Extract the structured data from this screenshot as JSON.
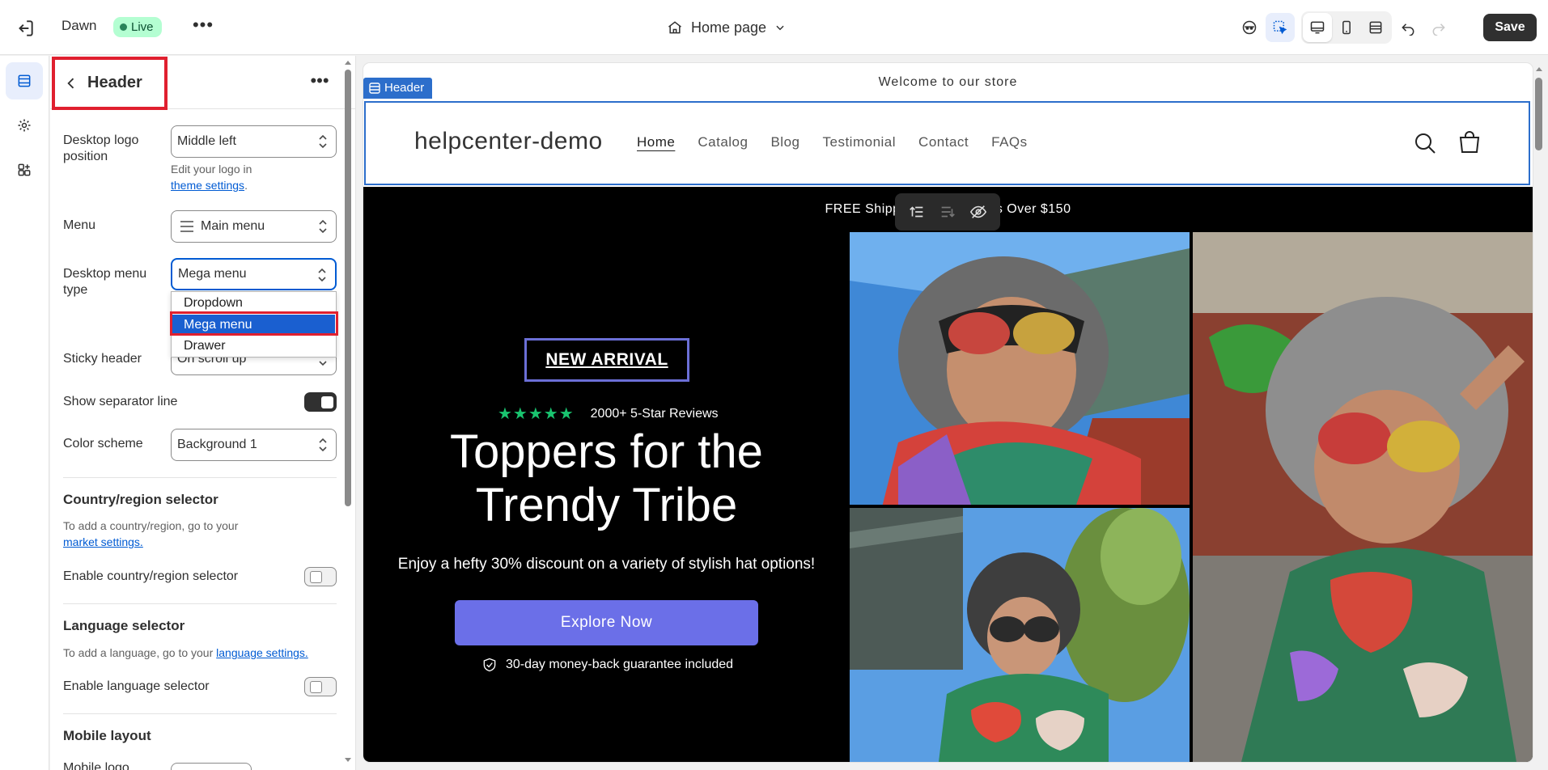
{
  "topbar": {
    "theme_name": "Dawn",
    "status": "Live",
    "more": "•••",
    "page_selector": "Home page",
    "save_label": "Save"
  },
  "panel": {
    "title": "Header",
    "more": "•••",
    "fields": {
      "logo_position_label": "Desktop logo position",
      "logo_position_value": "Middle left",
      "logo_help_prefix": "Edit your logo in",
      "logo_help_link": "theme settings",
      "menu_label": "Menu",
      "menu_value": "Main menu",
      "menu_type_label": "Desktop menu type",
      "menu_type_value": "Mega menu",
      "sticky_label": "Sticky header",
      "sticky_value": "On scroll up",
      "separator_label": "Show separator line",
      "separator_on": true,
      "color_scheme_label": "Color scheme",
      "color_scheme_value": "Background 1"
    },
    "dropdown_options": [
      "Dropdown",
      "Mega menu",
      "Drawer"
    ],
    "dropdown_selected": "Mega menu",
    "country": {
      "title": "Country/region selector",
      "help_prefix": "To add a country/region, go to your",
      "help_link": "market settings.",
      "enable_label": "Enable country/region selector",
      "enabled": false
    },
    "language": {
      "title": "Language selector",
      "help_prefix": "To add a language, go to your",
      "help_link": "language settings.",
      "enable_label": "Enable language selector",
      "enabled": false
    },
    "mobile": {
      "title": "Mobile layout",
      "logo_label": "Mobile logo"
    }
  },
  "preview": {
    "announcement": "Welcome to our store",
    "section_tag": "Header",
    "store_name": "helpcenter-demo",
    "nav": [
      "Home",
      "Catalog",
      "Blog",
      "Testimonial",
      "Contact",
      "FAQs"
    ],
    "free_shipping": "FREE Shipping on All Orders Over $150",
    "badge": "NEW ARRIVAL",
    "reviews": "2000+ 5-Star Reviews",
    "hero_title_line1": "Toppers for the",
    "hero_title_line2": "Trendy Tribe",
    "hero_subtitle": "Enjoy a hefty 30% discount on a variety of stylish hat options!",
    "cta": "Explore Now",
    "guarantee": "30-day money-back guarantee included"
  },
  "colors": {
    "accent": "#005bd3",
    "highlight": "#e0202f",
    "cta": "#6b6fe8",
    "star": "#19c46f",
    "live_bg": "#b4fed2"
  }
}
